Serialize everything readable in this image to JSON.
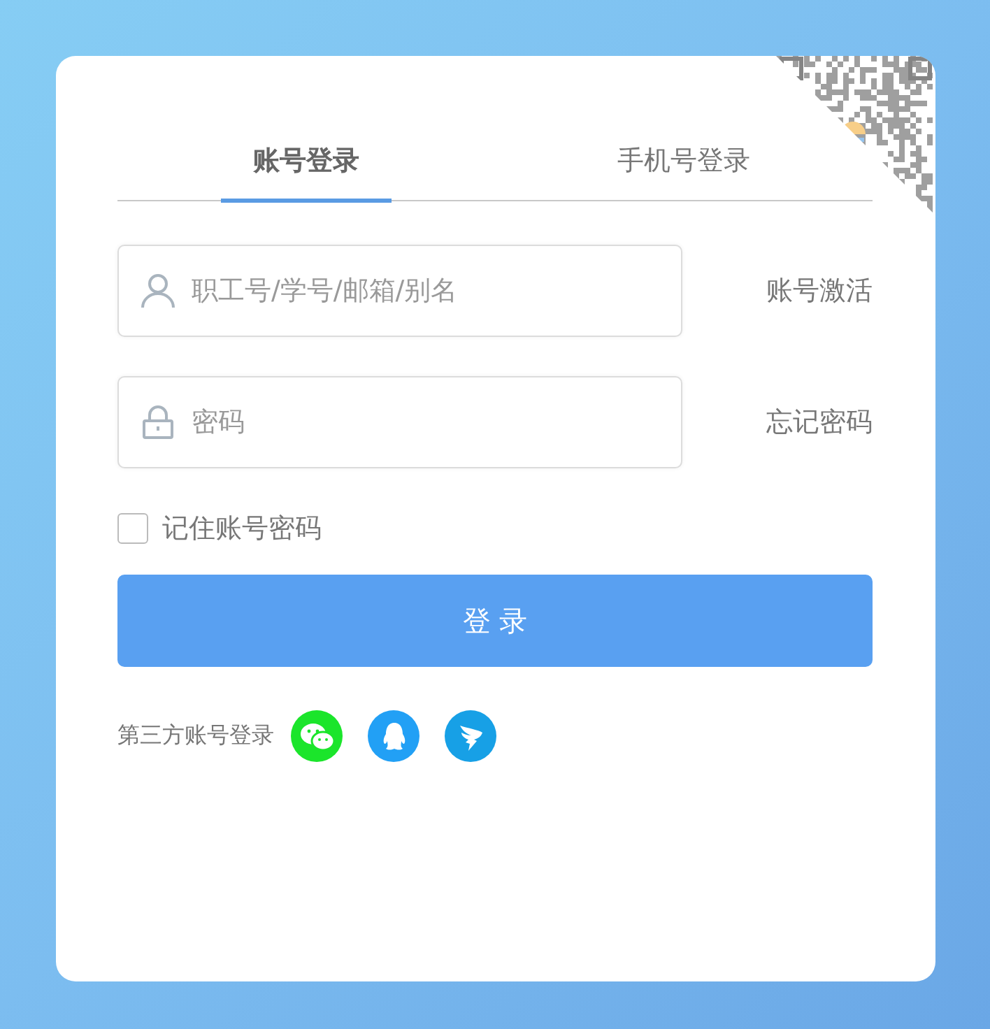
{
  "tabs": [
    {
      "label": "账号登录",
      "selected": true
    },
    {
      "label": "手机号登录",
      "selected": false
    }
  ],
  "fields": [
    {
      "kind": "user",
      "placeholder": "职工号/学号/邮箱/别名",
      "link": "账号激活"
    },
    {
      "kind": "password",
      "placeholder": "密码",
      "link": "忘记密码"
    }
  ],
  "remember": {
    "label": "记住账号密码",
    "checked": false
  },
  "login_button": "登 录",
  "third_party": {
    "label": "第三方账号登录",
    "providers": [
      {
        "kind": "wechat"
      },
      {
        "kind": "qq"
      },
      {
        "kind": "dingtalk"
      }
    ]
  }
}
